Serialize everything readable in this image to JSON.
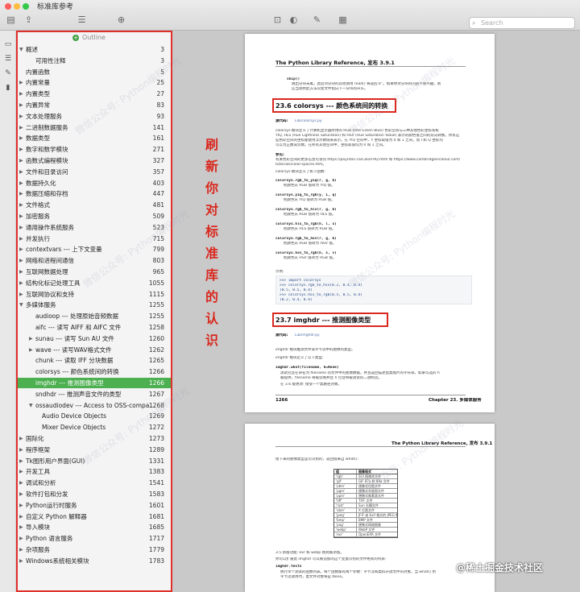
{
  "window": {
    "title": "标准库参考",
    "search_placeholder": "Search"
  },
  "toolbar": {
    "icons": [
      "sidebar-toggle-icon",
      "share-icon",
      "sidebar-list-icon",
      "zoom-icon",
      "rotate-icon",
      "markup-icon",
      "annotate-icon"
    ]
  },
  "sidebar": {
    "outline_label": "Outline",
    "items": [
      {
        "label": "概述",
        "page": "3",
        "level": 0,
        "arrow": "down"
      },
      {
        "label": "可用性注释",
        "page": "3",
        "level": 1,
        "arrow": ""
      },
      {
        "label": "内置函数",
        "page": "5",
        "level": 0,
        "arrow": ""
      },
      {
        "label": "内置常量",
        "page": "25",
        "level": 0,
        "arrow": "right"
      },
      {
        "label": "内置类型",
        "page": "27",
        "level": 0,
        "arrow": "right"
      },
      {
        "label": "内置异常",
        "page": "83",
        "level": 0,
        "arrow": "right"
      },
      {
        "label": "文本处理服务",
        "page": "93",
        "level": 0,
        "arrow": "right"
      },
      {
        "label": "二进制数据服务",
        "page": "141",
        "level": 0,
        "arrow": "right"
      },
      {
        "label": "数据类型",
        "page": "161",
        "level": 0,
        "arrow": "right"
      },
      {
        "label": "数字和数学模块",
        "page": "271",
        "level": 0,
        "arrow": "right"
      },
      {
        "label": "函数式编程模块",
        "page": "327",
        "level": 0,
        "arrow": "right"
      },
      {
        "label": "文件和目录访问",
        "page": "357",
        "level": 0,
        "arrow": "right"
      },
      {
        "label": "数据持久化",
        "page": "403",
        "level": 0,
        "arrow": "right"
      },
      {
        "label": "数据压缩和存档",
        "page": "447",
        "level": 0,
        "arrow": "right"
      },
      {
        "label": "文件格式",
        "page": "481",
        "level": 0,
        "arrow": "right"
      },
      {
        "label": "加密服务",
        "page": "509",
        "level": 0,
        "arrow": "right"
      },
      {
        "label": "通用操作系统服务",
        "page": "523",
        "level": 0,
        "arrow": "right"
      },
      {
        "label": "并发执行",
        "page": "715",
        "level": 0,
        "arrow": "right"
      },
      {
        "label": "contextvars --- 上下文变量",
        "page": "799",
        "level": 0,
        "arrow": "right"
      },
      {
        "label": "网络和进程间通信",
        "page": "803",
        "level": 0,
        "arrow": "right"
      },
      {
        "label": "互联网数据处理",
        "page": "965",
        "level": 0,
        "arrow": "right"
      },
      {
        "label": "结构化标记处理工具",
        "page": "1055",
        "level": 0,
        "arrow": "right"
      },
      {
        "label": "互联网协议和支持",
        "page": "1115",
        "level": 0,
        "arrow": "right"
      },
      {
        "label": "多媒体服务",
        "page": "1255",
        "level": 0,
        "arrow": "down"
      },
      {
        "label": "audioop --- 处理原始音频数据",
        "page": "1255",
        "level": 1,
        "arrow": ""
      },
      {
        "label": "aifc --- 读写 AIFF 和 AIFC 文件",
        "page": "1258",
        "level": 1,
        "arrow": ""
      },
      {
        "label": "sunau --- 读写 Sun AU 文件",
        "page": "1260",
        "level": 1,
        "arrow": "right"
      },
      {
        "label": "wave --- 读写WAV格式文件",
        "page": "1262",
        "level": 1,
        "arrow": "right"
      },
      {
        "label": "chunk --- 读取 IFF 分块数据",
        "page": "1265",
        "level": 1,
        "arrow": ""
      },
      {
        "label": "colorsys --- 颜色系统间的转换",
        "page": "1266",
        "level": 1,
        "arrow": ""
      },
      {
        "label": "imghdr --- 推测图像类型",
        "page": "1266",
        "level": 1,
        "arrow": "",
        "selected": true
      },
      {
        "label": "sndhdr --- 推测声音文件的类型",
        "page": "1267",
        "level": 1,
        "arrow": ""
      },
      {
        "label": "ossaudiodev --- Access to OSS-compa...",
        "page": "1268",
        "level": 1,
        "arrow": "down"
      },
      {
        "label": "Audio Device Objects",
        "page": "1269",
        "level": 2,
        "arrow": ""
      },
      {
        "label": "Mixer Device Objects",
        "page": "1272",
        "level": 2,
        "arrow": ""
      },
      {
        "label": "国际化",
        "page": "1273",
        "level": 0,
        "arrow": "right"
      },
      {
        "label": "程序框架",
        "page": "1289",
        "level": 0,
        "arrow": "right"
      },
      {
        "label": "Tk图形用户界面(GUI)",
        "page": "1331",
        "level": 0,
        "arrow": "right"
      },
      {
        "label": "开发工具",
        "page": "1383",
        "level": 0,
        "arrow": "right"
      },
      {
        "label": "调试和分析",
        "page": "1541",
        "level": 0,
        "arrow": "right"
      },
      {
        "label": "软件打包和分发",
        "page": "1583",
        "level": 0,
        "arrow": "right"
      },
      {
        "label": "Python运行时服务",
        "page": "1601",
        "level": 0,
        "arrow": "right"
      },
      {
        "label": "自定义 Python 解释器",
        "page": "1681",
        "level": 0,
        "arrow": "right"
      },
      {
        "label": "导入模块",
        "page": "1685",
        "level": 0,
        "arrow": "right"
      },
      {
        "label": "Python 语言服务",
        "page": "1717",
        "level": 0,
        "arrow": "right"
      },
      {
        "label": "杂项服务",
        "page": "1779",
        "level": 0,
        "arrow": "right"
      },
      {
        "label": "Windows系统相关模块",
        "page": "1783",
        "level": 0,
        "arrow": "right"
      }
    ]
  },
  "annotation": {
    "text": "刷新你对标准库的认识"
  },
  "page1": {
    "header": "The Python Library Reference, 发布 3.9.1",
    "skip_code": "skip()",
    "skip_text1": "跳出分块末尾，此后对分块的其他调用 read() 将返回 b''。如果你对分块的内容不感兴趣，则",
    "skip_text2": "应当调用此方法以使文件指向下一分块的开头。",
    "section1": "23.6  colorsys --- 颜色系统间的转换",
    "source1_label": "源代码:",
    "source1_link": "Lib/colorsys.py",
    "body1": [
      "colorsys 模块定义了计算机显示器所用的 RGB (Red Green Blue) 色彩空间与三种其他色彩坐标系统",
      "YIQ, HLS (Hue Lightness Saturation) 和 HSV (Hue Saturation Value) 表示的颜色值之间的双向转换。所有这",
      "些色彩空间的坐标都使用浮点数值来表示。在 YIQ 空间中，Y 坐标取值为 0 和 1 之间，而 I 和 Q 坐标均",
      "可以为正数或负数。在所有其他空间中，坐标取值均为 0 和 1 之间。"
    ],
    "seealso_label": "参见:",
    "seealso_text": "有关色彩空间的更多信息可访问 https://poynton.ca/ColorFAQ.html 和 https://www.cambridgeincolour.com/",
    "seealso_text2": "tutorials/color-spaces.htm。",
    "defines": "colorsys 模块定义了如下函数:",
    "funcs": [
      {
        "sig": "colorsys.rgb_to_yiq(r, g, b)",
        "desc": "把颜色从 RGB 值转为 YIQ 值。"
      },
      {
        "sig": "colorsys.yiq_to_rgb(y, i, q)",
        "desc": "把颜色从 YIQ 值转为 RGB 值。"
      },
      {
        "sig": "colorsys.rgb_to_hls(r, g, b)",
        "desc": "把颜色从 RGB 值转为 HLS 值。"
      },
      {
        "sig": "colorsys.hls_to_rgb(h, l, s)",
        "desc": "把颜色从 HLS 值转为 RGB 值。"
      },
      {
        "sig": "colorsys.rgb_to_hsv(r, g, b)",
        "desc": "把颜色从 RGB 值转为 HSV 值。"
      },
      {
        "sig": "colorsys.hsv_to_rgb(h, s, v)",
        "desc": "把颜色从 HSV 值转为 RGB 值。"
      }
    ],
    "example_label": "示例:",
    "code": [
      ">>> import colorsys",
      ">>> colorsys.rgb_to_hsv(0.2, 0.4, 0.4)",
      "(0.5, 0.5, 0.4)",
      ">>> colorsys.hsv_to_rgb(0.5, 0.5, 0.4)",
      "(0.2, 0.4, 0.4)"
    ],
    "section2": "23.7  imghdr --- 推测图像类型",
    "source2_label": "源代码:",
    "source2_link": "Lib/imghdr.py",
    "body2": "imghdr 模块推测文件或字节流中的图像的类型。",
    "defines2": "imghdr 模块定义了以下类型:",
    "what_sig": "imghdr.what(filename, h=None)",
    "what_desc1": "测试包含在命名为 filename 的文件中的图像数据，并且返回描述此类图片的字符串。如果可选的 h",
    "what_desc2": "被提供，filename 将被忽略并且 h 包含将被测试的二进制流。",
    "what_desc3": "在 3.6 版更改: 接受一个类路径对象。",
    "footer_page": "1266",
    "footer_chapter": "Chapter 23.  多媒体服务"
  },
  "page2": {
    "header": "The Python Library Reference, 发布 3.9.1",
    "intro": "接下来的图像类型是可识别的，返回值来自 what():",
    "table_head": [
      "值",
      "图像格式"
    ],
    "table": [
      [
        "'rgb'",
        "SGI 图像库文件"
      ],
      [
        "'gif'",
        "GIF 87a 和 89a 文件"
      ],
      [
        "'pbm'",
        "便携式位图文件"
      ],
      [
        "'pgm'",
        "便携式灰度图文件"
      ],
      [
        "'ppm'",
        "便携式像素表文件"
      ],
      [
        "'tiff'",
        "TIFF 文件"
      ],
      [
        "'rast'",
        "Sun 光栅文件"
      ],
      [
        "'xbm'",
        "X 位图文件"
      ],
      [
        "'jpeg'",
        "JFIF 或 Exif 格式的 JPEG 数据"
      ],
      [
        "'bmp'",
        "BMP 文件"
      ],
      [
        "'png'",
        "便携式网络图像"
      ],
      [
        "'webp'",
        "WebP 文件"
      ],
      [
        "'exr'",
        "OpenEXR 文件"
      ]
    ],
    "note1": "3.5 新版功能: exr 和 webp 格式被添加。",
    "note2": "你可以扩展此 imghdr 可以被追加的这个变量识别的文件格式的列表:",
    "tests": "imghdr.tests",
    "tests_desc": "执行单个测试的函数列表。每个函数都有两个参数：字节流和类似开放文件的对象。当 what() 用",
    "tests_desc2": "字节流调用时，类文件对象将是 None。"
  },
  "watermark": "微信公众号: Python编程时光",
  "credit": "@稀土掘金技术社区"
}
